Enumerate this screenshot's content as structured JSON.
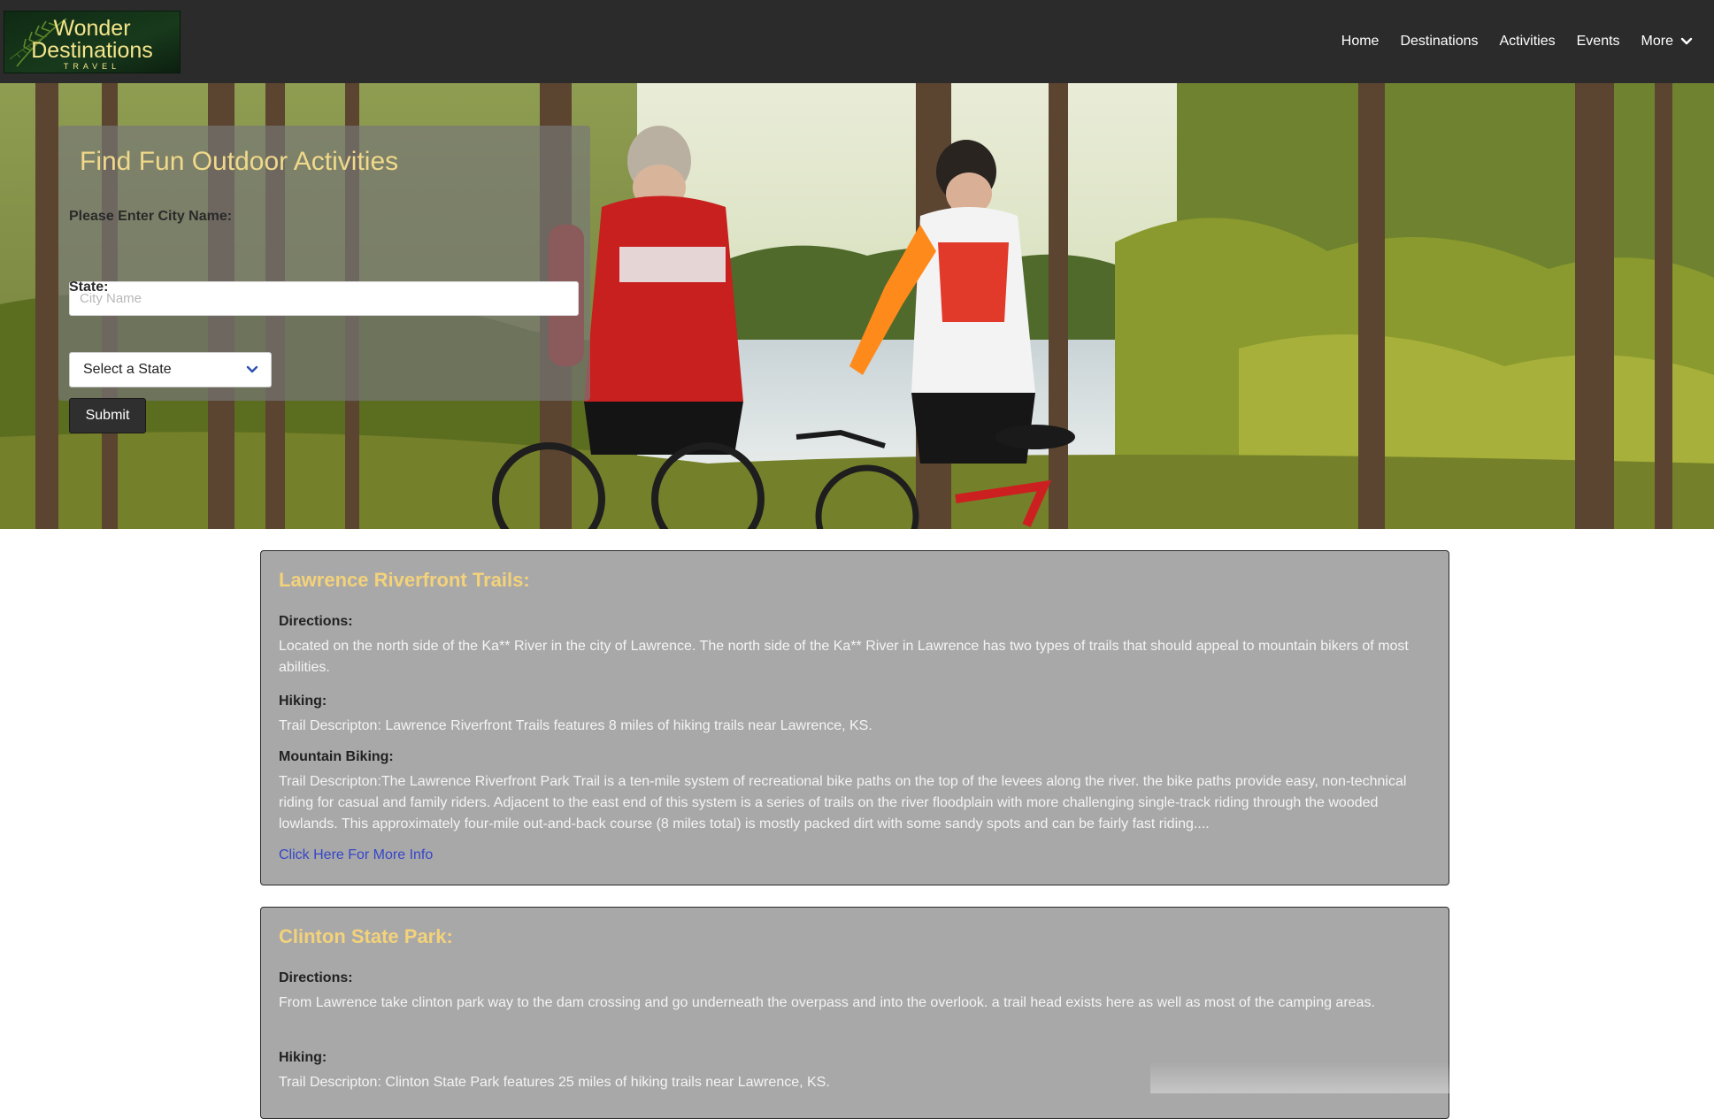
{
  "brand": {
    "line1": "Wonder",
    "line2": "Destinations",
    "line3": "TRAVEL"
  },
  "nav": {
    "items": [
      "Home",
      "Destinations",
      "Activities",
      "Events"
    ],
    "more_label": "More"
  },
  "search": {
    "title": "Find Fun Outdoor Activities",
    "city_label": "Please Enter City Name:",
    "city_placeholder": "City Name",
    "city_value": "",
    "state_label": "State:",
    "state_selected": "Select a State",
    "submit_label": "Submit"
  },
  "results": [
    {
      "title": "Lawrence Riverfront Trails:",
      "directions_label": "Directions:",
      "directions_text": "Located on the north side of the Ka** River in the city of Lawrence. The north side of the Ka** River in Lawrence has two types of trails that should appeal to mountain bikers of most abilities.",
      "hiking_label": "Hiking:",
      "hiking_text": "Trail Descripton: Lawrence Riverfront Trails features 8 miles of hiking trails near Lawrence, KS.",
      "biking_label": "Mountain Biking:",
      "biking_text": "Trail Descripton:The Lawrence Riverfront Park Trail is a ten-mile system of recreational bike paths on the top of the levees along the river. the bike paths provide easy, non-technical riding for casual and family riders. Adjacent to the east end of this system is a series of trails on the river floodplain with more challenging single-track riding through the wooded lowlands. This approximately four-mile out-and-back course (8 miles total) is mostly packed dirt with some sandy spots and can be fairly fast riding....",
      "more_info_label": "Click Here For More Info"
    },
    {
      "title": "Clinton State Park:",
      "directions_label": "Directions:",
      "directions_text": "From Lawrence take clinton park way to the dam crossing and go underneath the overpass and into the overlook. a trail head exists here as well as most of the camping areas.",
      "hiking_label": "Hiking:",
      "hiking_text": "Trail Descripton: Clinton State Park features 25 miles of hiking trails near Lawrence, KS."
    }
  ],
  "colors": {
    "navbar_bg": "#2b2b2b",
    "accent_gold": "#f3d27a",
    "card_bg": "#a8a8a8",
    "link_blue": "#3446c8"
  }
}
